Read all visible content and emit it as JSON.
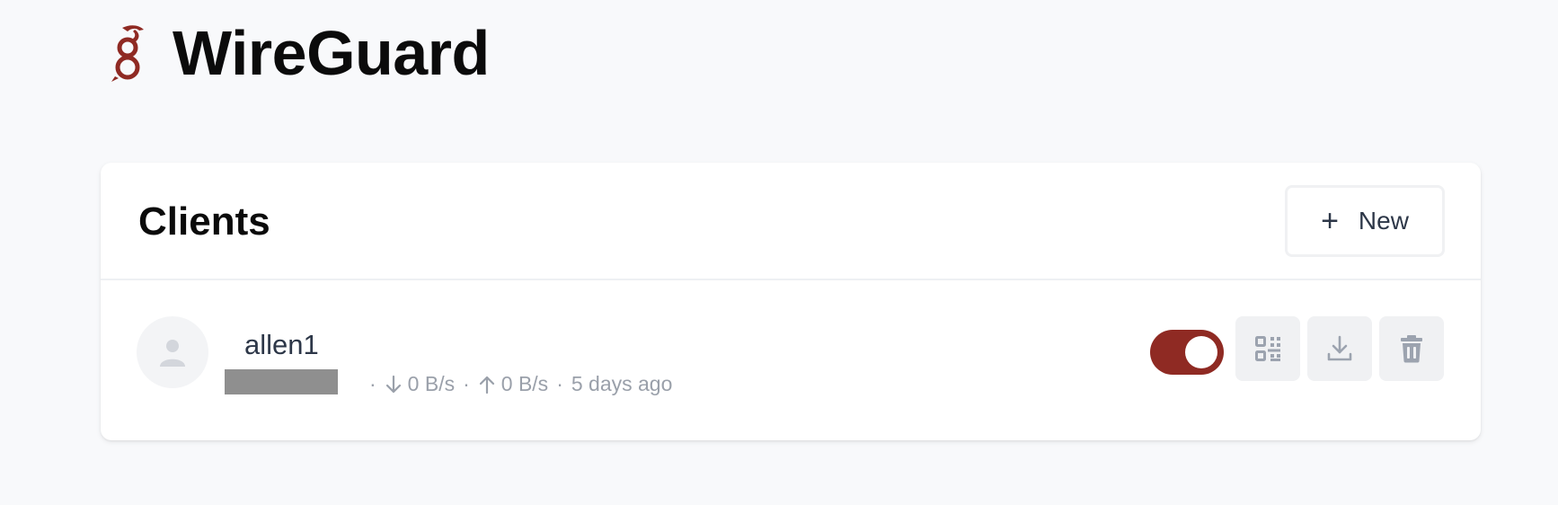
{
  "app": {
    "title": "WireGuard",
    "brand_color": "#8f2a23"
  },
  "clients_panel": {
    "title": "Clients",
    "new_button_icon": "plus-icon",
    "new_button_label": "New"
  },
  "clients": [
    {
      "name": "allen1",
      "address_redacted": true,
      "download_rate": "0 B/s",
      "upload_rate": "0 B/s",
      "last_seen": "5 days ago",
      "enabled": true,
      "actions": [
        "qr-code-icon",
        "download-icon",
        "trash-icon"
      ]
    }
  ],
  "meta_separator": "·",
  "colors": {
    "background": "#f8f9fb",
    "card": "#ffffff",
    "muted_text": "#9aa0aa",
    "icon_gray": "#9ca3af",
    "button_bg": "#f0f1f3"
  }
}
